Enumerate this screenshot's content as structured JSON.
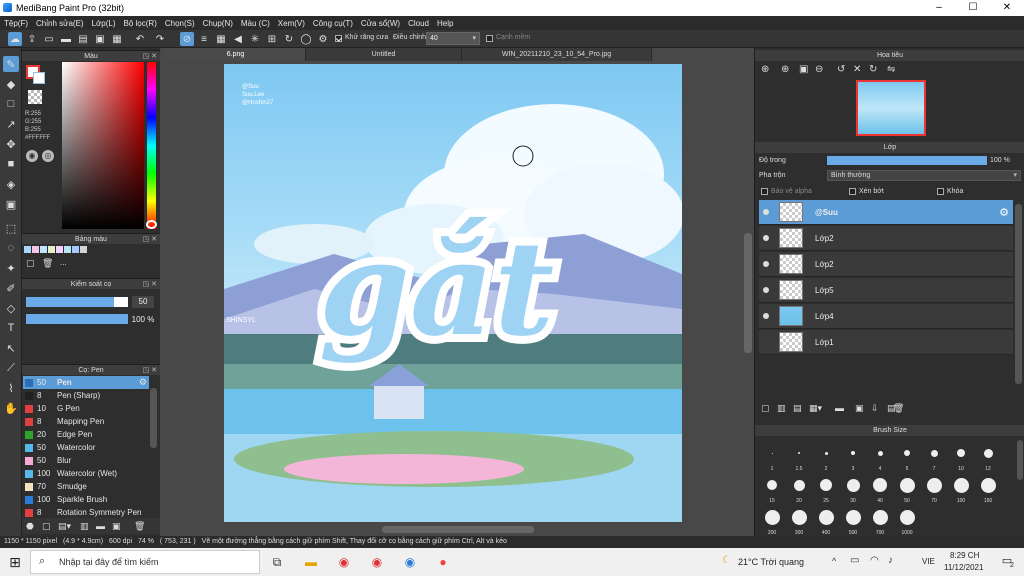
{
  "window": {
    "title": "MediBang Paint Pro (32bit)",
    "controls": [
      "–",
      "☐",
      "✕"
    ]
  },
  "menu": [
    "Tệp(F)",
    "Chỉnh sửa(E)",
    "Lớp(L)",
    "Bộ lọc(R)",
    "Chọn(S)",
    "Chụp(N)",
    "Màu (C)",
    "Xem(V)",
    "Công cụ(T)",
    "Cửa sổ(W)",
    "Cloud",
    "Help"
  ],
  "toolbar": {
    "antialias_label": "Khử răng cưa",
    "adjust_label": "Điều chỉnh",
    "adjust_value": "40",
    "smooth_label": "Cạnh mềm"
  },
  "color_panel": {
    "title": "Màu",
    "r": "R:255",
    "g": "G:255",
    "b": "B:255",
    "hex": "#FFFFFF",
    "fg_color": "#ffffff",
    "bg_color": "#000000"
  },
  "palette_panel": {
    "title": "Bảng màu",
    "colors": [
      "#a8d8ff",
      "#f4c6e4",
      "#bfe6ff",
      "#e2f1c6",
      "#f7d1ff",
      "#b6e7f2",
      "#a5c8ff",
      "#d4d4d4"
    ],
    "more": "..."
  },
  "brush_control": {
    "title": "Kiểm soát cọ",
    "size_value": "50",
    "size_fraction": 0.86,
    "opacity_value": "100 %",
    "opacity_fraction": 1.0
  },
  "brush_list": {
    "title": "Cọ: Pen",
    "items": [
      {
        "size": "50",
        "name": "Pen",
        "color": "#2c6fb6",
        "selected": true
      },
      {
        "size": "8",
        "name": "Pen (Sharp)",
        "color": "#202020"
      },
      {
        "size": "10",
        "name": "G Pen",
        "color": "#e04040"
      },
      {
        "size": "8",
        "name": "Mapping Pen",
        "color": "#e04040"
      },
      {
        "size": "20",
        "name": "Edge Pen",
        "color": "#2da52d"
      },
      {
        "size": "50",
        "name": "Watercolor",
        "color": "#58b8e8"
      },
      {
        "size": "50",
        "name": "Blur",
        "color": "#f8a8d8"
      },
      {
        "size": "100",
        "name": "Watercolor (Wet)",
        "color": "#58b8e8"
      },
      {
        "size": "70",
        "name": "Smudge",
        "color": "#f0e0c0"
      },
      {
        "size": "100",
        "name": "Sparkle Brush",
        "color": "#2d7ad8"
      },
      {
        "size": "8",
        "name": "Rotation Symmetry Pen",
        "color": "#e04040"
      }
    ]
  },
  "tabs": [
    "6.png",
    "Untitled",
    "WIN_20211210_23_10_54_Pro.jpg"
  ],
  "canvas": {
    "credit_lines": [
      "@Suu",
      "Suu.Lee",
      "@Hoshin27"
    ],
    "artwork_text": "gắt",
    "side_text": "SHINSYL"
  },
  "navigator": {
    "title": "Hoa tiêu"
  },
  "layers_panel": {
    "title": "Lớp",
    "opacity_label": "Độ trong",
    "opacity_value": "100 %",
    "opacity_fraction": 1.0,
    "blend_label": "Pha trộn",
    "blend_value": "Bình thường",
    "protect_alpha": "Bảo vệ alpha",
    "clipping": "Xén bớt",
    "lock": "Khóa",
    "layers": [
      {
        "name": "@Suu",
        "selected": true
      },
      {
        "name": "Lớp2"
      },
      {
        "name": "Lớp2"
      },
      {
        "name": "Lớp5"
      },
      {
        "name": "Lớp4"
      },
      {
        "name": "Lớp1"
      }
    ]
  },
  "brush_size_panel": {
    "title": "Brush Size",
    "sizes": [
      "1",
      "1.5",
      "2",
      "3",
      "4",
      "5",
      "7",
      "10",
      "12",
      "15",
      "20",
      "25",
      "30",
      "40",
      "50",
      "70",
      "100",
      "150",
      "200",
      "300",
      "400",
      "500",
      "700",
      "1000"
    ]
  },
  "status": {
    "dimensions": "1150 * 1150 pixel",
    "physical": "(4.9 * 4.9cm)",
    "dpi": "600 dpi",
    "zoom": "74 %",
    "cursor": "( 753, 231 )",
    "hint": "Vẽ một đường thẳng bằng cách giữ phím Shift, Thay đổi cỡ cọ bằng cách giữ phím Ctrl, Alt và kéo"
  },
  "taskbar": {
    "search_placeholder": "Nhập tại đây để tìm kiếm",
    "weather": "21°C  Trời quang",
    "lang": "VIE",
    "time": "8:29 CH",
    "date": "11/12/2021",
    "notifications": "2"
  }
}
